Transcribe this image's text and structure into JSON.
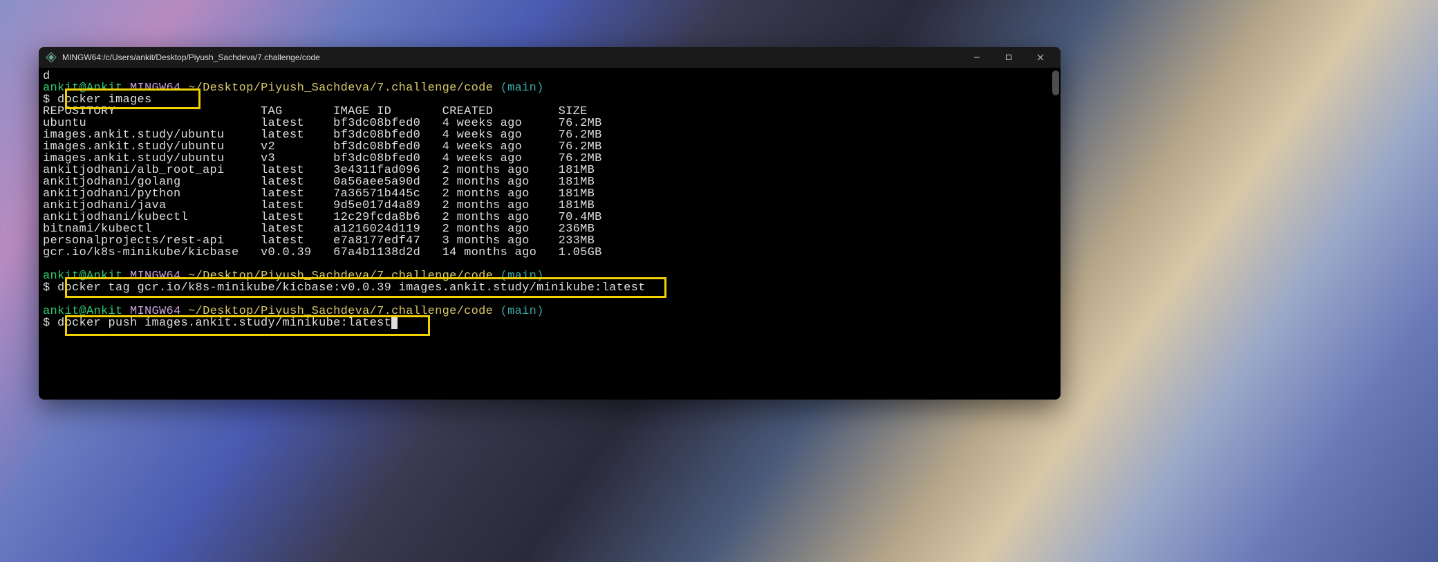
{
  "window": {
    "title": "MINGW64:/c/Users/ankit/Desktop/Piyush_Sachdeva/7.challenge/code"
  },
  "overflow_line": "d",
  "prompt": {
    "user": "ankit",
    "at": "@",
    "host": "Ankit",
    "shell": "MINGW64",
    "path": "~/Desktop/Piyush_Sachdeva/7.challenge/code",
    "branch": "(main)",
    "symbol": "$"
  },
  "cmd1": "docker images",
  "table": {
    "header": {
      "repo": "REPOSITORY",
      "tag": "TAG",
      "id": "IMAGE ID",
      "created": "CREATED",
      "size": "SIZE"
    },
    "rows": [
      {
        "repo": "ubuntu",
        "tag": "latest",
        "id": "bf3dc08bfed0",
        "created": "4 weeks ago",
        "size": "76.2MB"
      },
      {
        "repo": "images.ankit.study/ubuntu",
        "tag": "latest",
        "id": "bf3dc08bfed0",
        "created": "4 weeks ago",
        "size": "76.2MB"
      },
      {
        "repo": "images.ankit.study/ubuntu",
        "tag": "v2",
        "id": "bf3dc08bfed0",
        "created": "4 weeks ago",
        "size": "76.2MB"
      },
      {
        "repo": "images.ankit.study/ubuntu",
        "tag": "v3",
        "id": "bf3dc08bfed0",
        "created": "4 weeks ago",
        "size": "76.2MB"
      },
      {
        "repo": "ankitjodhani/alb_root_api",
        "tag": "latest",
        "id": "3e4311fad096",
        "created": "2 months ago",
        "size": "181MB"
      },
      {
        "repo": "ankitjodhani/golang",
        "tag": "latest",
        "id": "0a56aee5a90d",
        "created": "2 months ago",
        "size": "181MB"
      },
      {
        "repo": "ankitjodhani/python",
        "tag": "latest",
        "id": "7a36571b445c",
        "created": "2 months ago",
        "size": "181MB"
      },
      {
        "repo": "ankitjodhani/java",
        "tag": "latest",
        "id": "9d5e017d4a89",
        "created": "2 months ago",
        "size": "181MB"
      },
      {
        "repo": "ankitjodhani/kubectl",
        "tag": "latest",
        "id": "12c29fcda8b6",
        "created": "2 months ago",
        "size": "70.4MB"
      },
      {
        "repo": "bitnami/kubectl",
        "tag": "latest",
        "id": "a1216024d119",
        "created": "2 months ago",
        "size": "236MB"
      },
      {
        "repo": "personalprojects/rest-api",
        "tag": "latest",
        "id": "e7a8177edf47",
        "created": "3 months ago",
        "size": "233MB"
      },
      {
        "repo": "gcr.io/k8s-minikube/kicbase",
        "tag": "v0.0.39",
        "id": "67a4b1138d2d",
        "created": "14 months ago",
        "size": "1.05GB"
      }
    ]
  },
  "cmd2": "docker tag gcr.io/k8s-minikube/kicbase:v0.0.39 images.ankit.study/minikube:latest",
  "cmd3": "docker push images.ankit.study/minikube:latest",
  "col_widths": {
    "repo": 30,
    "tag": 10,
    "id": 15,
    "created": 16,
    "size": 8
  }
}
